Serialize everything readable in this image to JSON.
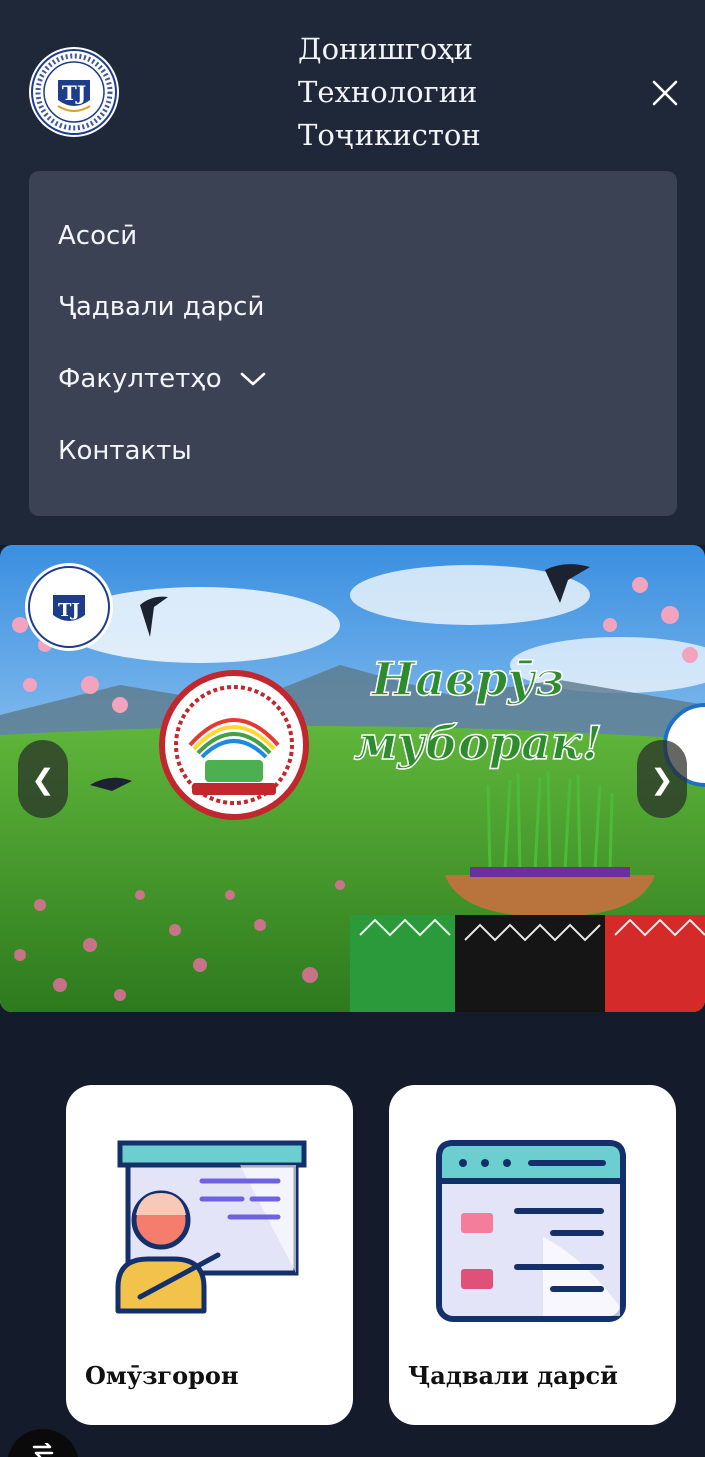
{
  "header": {
    "site_title_line1": "Донишгоҳи",
    "site_title_line2": "Технологии",
    "site_title_line3": "Тоҷикистон",
    "logo_icon": "university-seal-icon",
    "close_icon": "close-icon"
  },
  "menu": {
    "items": [
      {
        "label": "Асосӣ"
      },
      {
        "label": "Ҷадвали дарсӣ"
      },
      {
        "label": "Факултетҳо",
        "icon": "chevron-down-icon"
      },
      {
        "label": "Контакты"
      }
    ]
  },
  "hero": {
    "banner_text_line1": "Наврӯз",
    "banner_text_line2": "муборак!",
    "prev_label": "❮",
    "next_label": "❯"
  },
  "cards": [
    {
      "label": "Омӯзгорон",
      "icon": "teacher-presentation-icon"
    },
    {
      "label": "Ҷадвали дарсӣ",
      "icon": "schedule-window-icon"
    }
  ],
  "colors": {
    "page_bg": "#141b2b",
    "header_bg": "#1f2838",
    "menu_bg": "#3a4254",
    "icon_navy": "#14306b",
    "icon_teal": "#6ccfcf",
    "icon_lavender": "#e4e4f8",
    "icon_pink": "#f47d9c"
  }
}
